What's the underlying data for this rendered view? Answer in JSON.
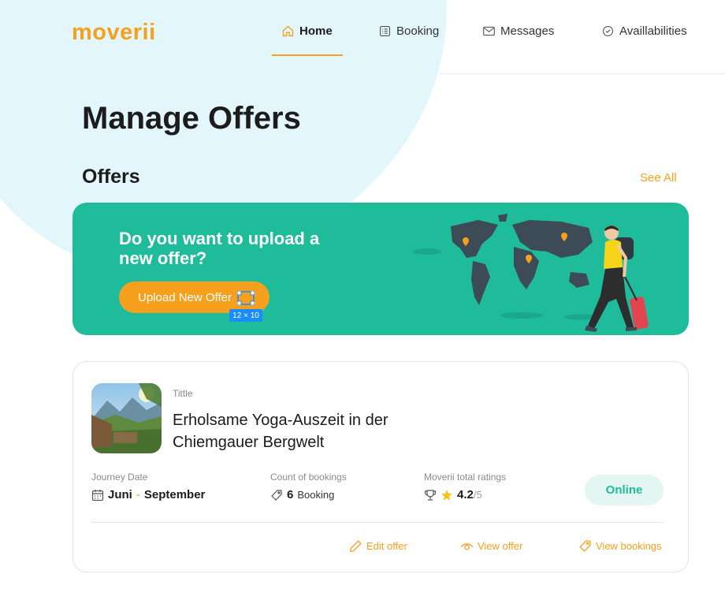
{
  "brand": {
    "logo": "moverii",
    "accent": "#f6a11c",
    "teal": "#1fbc9c"
  },
  "nav": {
    "home": "Home",
    "booking": "Booking",
    "messages": "Messages",
    "availabilities": "Availlabilities"
  },
  "page": {
    "title": "Manage Offers"
  },
  "offers_section": {
    "title": "Offers",
    "see_all": "See All"
  },
  "banner": {
    "headline": "Do you want to upload a new offer?",
    "button": "Upload New Offer",
    "selection_badge": "12 × 10"
  },
  "offer": {
    "title_label": "Tittle",
    "title": "Erholsame Yoga-Auszeit in der Chiemgauer Bergwelt",
    "journey_label": "Journey Date",
    "journey_start": "Juni",
    "journey_sep": "-",
    "journey_end": "September",
    "bookings_label": "Count of bookings",
    "bookings_count": "6",
    "bookings_unit": "Booking",
    "ratings_label": "Moverii total ratings",
    "rating": "4.2",
    "rating_max": "/5",
    "status": "Online",
    "actions": {
      "edit": "Edit offer",
      "view": "View offer",
      "bookings": "View bookings"
    }
  }
}
